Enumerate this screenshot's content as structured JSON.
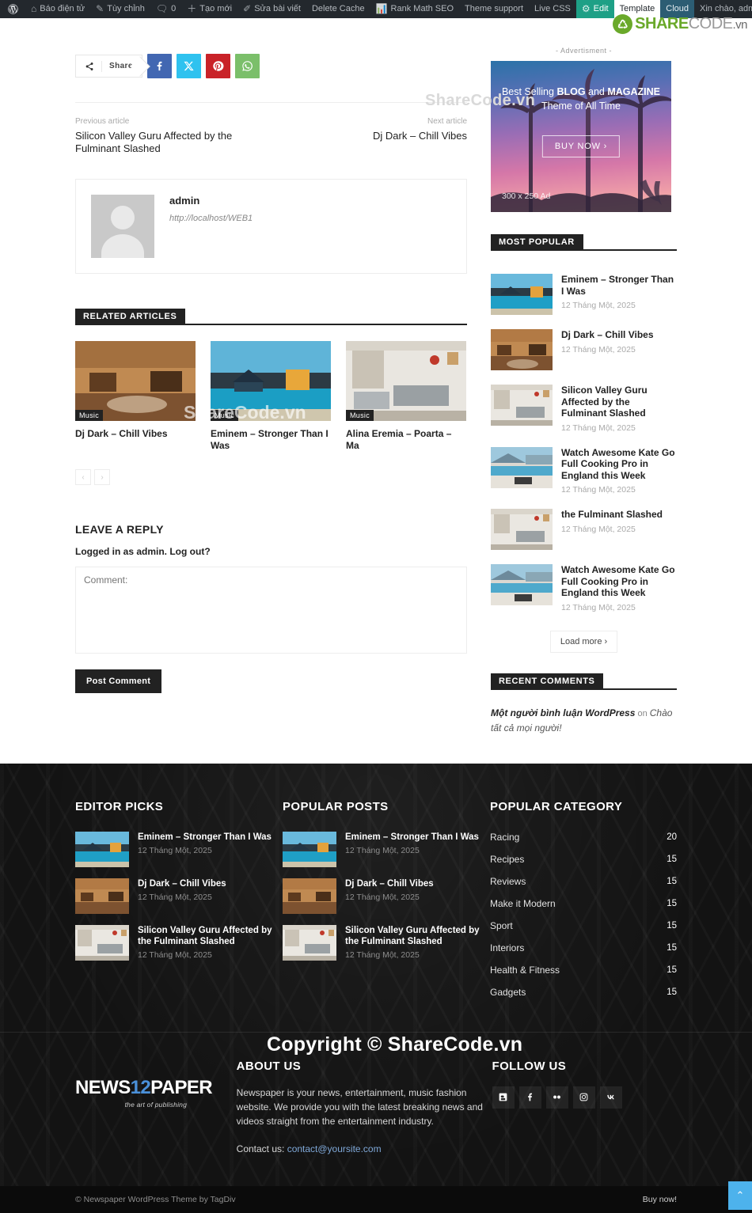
{
  "adminbar": {
    "wp_icon": "wordpress-icon",
    "items": [
      {
        "label": "Báo điện tử",
        "icon": "dashboard-icon",
        "style": "dark"
      },
      {
        "label": "Tùy chỉnh",
        "icon": "pencil-icon",
        "style": "dark"
      },
      {
        "label": "0",
        "icon": "comment-bubble-icon",
        "style": "dark"
      },
      {
        "label": "Tạo mới",
        "icon": "plus-icon",
        "style": "dark"
      },
      {
        "label": "Sửa bài viết",
        "icon": "edit-pencil-icon",
        "style": "dark"
      },
      {
        "label": "Delete Cache",
        "icon": "",
        "style": "dark"
      },
      {
        "label": "Rank Math SEO",
        "icon": "chart-icon",
        "style": "dark"
      },
      {
        "label": "Theme support",
        "icon": "",
        "style": "dark"
      },
      {
        "label": "Live CSS",
        "icon": "",
        "style": "dark"
      },
      {
        "label": "Edit",
        "icon": "gear-icon",
        "style": "green"
      },
      {
        "label": "Template",
        "icon": "",
        "style": "white"
      },
      {
        "label": "Cloud",
        "icon": "",
        "style": "blue"
      }
    ],
    "greeting": "Xin chào, admin",
    "search_icon": "search-icon"
  },
  "watermarks": {
    "top": "ShareCode.vn",
    "middle": "ShareCode.vn",
    "bottom": "Copyright © ShareCode.vn",
    "logo_share": "SHARE",
    "logo_code": "CODE",
    "logo_vn": ".vn"
  },
  "share": {
    "label": "Share",
    "buttons": [
      {
        "name": "facebook-share-button",
        "icon": "facebook-icon"
      },
      {
        "name": "twitter-share-button",
        "icon": "twitter-x-icon"
      },
      {
        "name": "pinterest-share-button",
        "icon": "pinterest-icon"
      },
      {
        "name": "whatsapp-share-button",
        "icon": "whatsapp-icon"
      }
    ]
  },
  "prev_next": {
    "prev_label": "Previous article",
    "prev_title": "Silicon Valley Guru Affected by the Fulminant Slashed",
    "next_label": "Next article",
    "next_title": "Dj Dark – Chill Vibes"
  },
  "author": {
    "name": "admin",
    "url": "http://localhost/WEB1"
  },
  "related": {
    "heading": "RELATED ARTICLES",
    "items": [
      {
        "title": "Dj Dark – Chill Vibes",
        "category": "Music"
      },
      {
        "title": "Eminem – Stronger Than I Was",
        "category": "Music"
      },
      {
        "title": "Alina Eremia – Poarta – Ma",
        "category": "Music"
      }
    ],
    "prev_arrow": "‹",
    "next_arrow": "›"
  },
  "comments": {
    "heading": "LEAVE A REPLY",
    "logged_in": "Logged in as admin. Log out?",
    "placeholder": "Comment:",
    "submit_label": "Post Comment"
  },
  "sidebar": {
    "ad_label": "- Advertisment -",
    "ad": {
      "line1_a": "Best Selling ",
      "line1_b": "BLOG",
      "line1_c": " and ",
      "line1_d": "MAGAZINE",
      "line2": "Theme of All Time",
      "cta": "BUY NOW  ›",
      "size": "300 x 250 Ad"
    },
    "most_popular_heading": "MOST POPULAR",
    "most_popular": [
      {
        "title": "Eminem – Stronger Than I Was",
        "date": "12 Tháng Một, 2025",
        "img": "pool"
      },
      {
        "title": "Dj Dark – Chill Vibes",
        "date": "12 Tháng Một, 2025",
        "img": "lounge"
      },
      {
        "title": "Silicon Valley Guru Affected by the Fulminant Slashed",
        "date": "12 Tháng Một, 2025",
        "img": "living"
      },
      {
        "title": "Watch Awesome Kate Go Full Cooking Pro in England this Week",
        "date": "12 Tháng Một, 2025",
        "img": "villa"
      },
      {
        "title": "the Fulminant Slashed",
        "date": "12 Tháng Một, 2025",
        "img": "living"
      },
      {
        "title": "Watch Awesome Kate Go Full Cooking Pro in England this Week",
        "date": "12 Tháng Một, 2025",
        "img": "villa"
      }
    ],
    "load_more": "Load more  ›",
    "recent_comments_heading": "RECENT COMMENTS",
    "recent_comment": {
      "author": "Một người bình luận WordPress",
      "on": " on ",
      "post": "Chào tất cả mọi người!"
    }
  },
  "footer": {
    "editor_picks_heading": "EDITOR PICKS",
    "editor_picks": [
      {
        "title": "Eminem – Stronger Than I Was",
        "date": "12 Tháng Một, 2025",
        "img": "pool"
      },
      {
        "title": "Dj Dark – Chill Vibes",
        "date": "12 Tháng Một, 2025",
        "img": "lounge"
      },
      {
        "title": "Silicon Valley Guru Affected by the Fulminant Slashed",
        "date": "12 Tháng Một, 2025",
        "img": "living"
      }
    ],
    "popular_posts_heading": "POPULAR POSTS",
    "popular_posts": [
      {
        "title": "Eminem – Stronger Than I Was",
        "date": "12 Tháng Một, 2025",
        "img": "pool"
      },
      {
        "title": "Dj Dark – Chill Vibes",
        "date": "12 Tháng Một, 2025",
        "img": "lounge"
      },
      {
        "title": "Silicon Valley Guru Affected by the Fulminant Slashed",
        "date": "12 Tháng Một, 2025",
        "img": "living"
      }
    ],
    "popular_category_heading": "POPULAR CATEGORY",
    "categories": [
      {
        "name": "Racing",
        "count": "20"
      },
      {
        "name": "Recipes",
        "count": "15"
      },
      {
        "name": "Reviews",
        "count": "15"
      },
      {
        "name": "Make it Modern",
        "count": "15"
      },
      {
        "name": "Sport",
        "count": "15"
      },
      {
        "name": "Interiors",
        "count": "15"
      },
      {
        "name": "Health & Fitness",
        "count": "15"
      },
      {
        "name": "Gadgets",
        "count": "15"
      }
    ],
    "logo": {
      "news": "NEWS",
      "twelve": "12",
      "paper": "PAPER",
      "tagline": "the art of publishing"
    },
    "about_heading": "ABOUT US",
    "about_text": "Newspaper is your news, entertainment, music fashion website. We provide you with the latest breaking news and videos straight from the entertainment industry.",
    "contact_prefix": "Contact us: ",
    "contact_email": "contact@yoursite.com",
    "follow_heading": "FOLLOW US",
    "social": [
      {
        "name": "blogger-icon"
      },
      {
        "name": "facebook-icon"
      },
      {
        "name": "flickr-icon"
      },
      {
        "name": "instagram-icon"
      },
      {
        "name": "vk-icon"
      }
    ],
    "copyright": "© Newspaper WordPress Theme by TagDiv",
    "buy_now": "Buy now!",
    "to_top_icon": "chevron-up-icon"
  }
}
